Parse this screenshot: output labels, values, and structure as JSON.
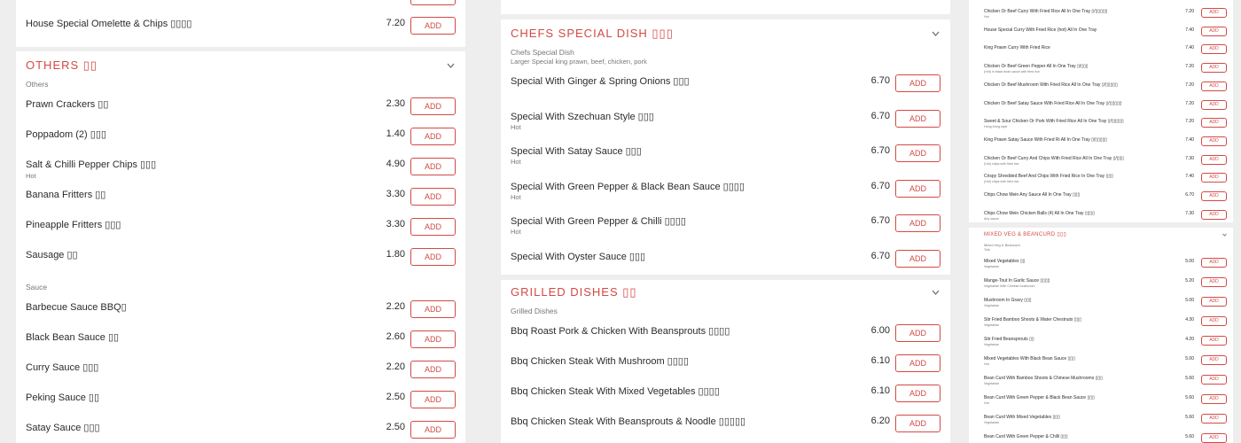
{
  "colA": {
    "top_item": {
      "name": "House Special Omelette & Chips ▯▯▯▯",
      "price": "7.20"
    },
    "others": {
      "title": "OTHERS ▯▯",
      "caption": "Others",
      "items": [
        {
          "name": "Prawn Crackers ▯▯",
          "price": "2.30"
        },
        {
          "name": "Poppadom (2) ▯▯▯",
          "price": "1.40"
        },
        {
          "name": "Salt & Chilli Pepper Chips ▯▯▯",
          "sub": "Hot",
          "price": "4.90"
        },
        {
          "name": "Banana Fritters ▯▯",
          "price": "3.30"
        },
        {
          "name": "Pineapple Fritters ▯▯▯",
          "price": "3.30"
        },
        {
          "name": "Sausage ▯▯",
          "price": "1.80"
        }
      ],
      "sauce_caption": "Sauce",
      "sauces": [
        {
          "name": "Barbecue Sauce BBQ▯",
          "price": "2.20"
        },
        {
          "name": "Black Bean Sauce ▯▯",
          "price": "2.60"
        },
        {
          "name": "Curry Sauce ▯▯▯",
          "price": "2.20"
        },
        {
          "name": "Peking Sauce ▯▯",
          "price": "2.50"
        },
        {
          "name": "Satay Sauce ▯▯▯",
          "price": "2.50"
        }
      ]
    }
  },
  "colB": {
    "chefs": {
      "title": "CHEFS SPECIAL DISH ▯▯▯",
      "caption": "Chefs Special Dish",
      "caption2": "Larger Special king prawn, beef, chicken, pork",
      "items": [
        {
          "name": "Special With Ginger & Spring Onions ▯▯▯",
          "price": "6.70"
        },
        {
          "name": "Special With Szechuan Style ▯▯▯",
          "sub": "Hot",
          "price": "6.70"
        },
        {
          "name": "Special With Satay Sauce ▯▯▯",
          "sub": "Hot",
          "price": "6.70"
        },
        {
          "name": "Special With Green Pepper & Black Bean Sauce ▯▯▯▯",
          "sub": "Hot",
          "price": "6.70"
        },
        {
          "name": "Special With Green Pepper & Chilli ▯▯▯▯",
          "sub": "Hot",
          "price": "6.70"
        },
        {
          "name": "Special With Oyster Sauce ▯▯▯",
          "price": "6.70"
        }
      ]
    },
    "grilled": {
      "title": "GRILLED DISHES ▯▯",
      "caption": "Grilled Dishes",
      "items": [
        {
          "name": "Bbq Roast Pork & Chicken With Beansprouts ▯▯▯▯",
          "price": "6.00"
        },
        {
          "name": "Bbq Chicken Steak With Mushroom ▯▯▯▯",
          "price": "6.10"
        },
        {
          "name": "Bbq Chicken Steak With Mixed Vegetables ▯▯▯▯",
          "price": "6.10"
        },
        {
          "name": "Bbq Chicken Steak With Beansprouts & Noodle ▯▯▯▯▯",
          "price": "6.20"
        }
      ]
    }
  },
  "colC": {
    "items": [
      {
        "name": "Chicken Or Beef Curry With Fried Rice All In One Tray ▯/▯▯▯▯▯",
        "sub": "Hot",
        "price": "7.20"
      },
      {
        "name": "House Special Curry With Fried Rice (hot) All In One Tray",
        "price": "7.40"
      },
      {
        "name": "King Prawn Curry With Fried Rice",
        "price": "7.40"
      },
      {
        "name": "Chicken Or Beef Green Pepper All In One Tray ▯/▯▯▯",
        "sub": "(Hot) in black bean sauce with fried rice",
        "price": "7.20"
      },
      {
        "name": "Chicken Or Beef Mushroom With Fried Rice All In One Tray ▯/▯▯▯▯▯",
        "price": "7.20"
      },
      {
        "name": "Chicken Or Beef Satay Sauce With Fried Rice All In One Tray ▯/▯▯▯▯▯",
        "price": "7.20"
      },
      {
        "name": "Sweet & Sour Chicken Or Pork With Fried Rice All In One Tray ▯/▯▯▯▯▯",
        "sub": "Hong Kong style",
        "price": "7.20"
      },
      {
        "name": "King Prawn Satay Sauce With Fried Ri All In One Tray ▯/▯▯▯▯▯",
        "price": "7.40"
      },
      {
        "name": "Chicken Or Beef Curry And Chips With Fried Rice All In One Tray ▯/▯▯▯",
        "sub": "(Hot) chips with fried rice",
        "price": "7.30"
      },
      {
        "name": "Crispy Shredded Beef And Chips With Fried Rice In One Tray ▯▯▯",
        "sub": "(Hot) chips with fried rice",
        "price": "7.40"
      },
      {
        "name": "Chips Chow Mein Any Sauce All In One Tray ▯▯▯",
        "price": "6.70"
      },
      {
        "name": "Chips Chow Mein Chicken Balls (4) All In One Tray ▯▯▯▯",
        "sub": "Any sauce",
        "price": "7.30"
      }
    ],
    "veg": {
      "title": "MIXED VEG & BEANCURD ▯▯▯",
      "caption": "Mixed Veg & Beancurd",
      "caption2": "Tofu",
      "items": [
        {
          "name": "Mixed Vegetables ▯▯",
          "sub": "Vegetarian",
          "price": "5.00"
        },
        {
          "name": "Mange-Tout In Garlic Sauce ▯▯▯▯",
          "sub": "Vegetarian With Chinese mushroom",
          "price": "5.20"
        },
        {
          "name": "Mushroom In Gravy ▯▯▯",
          "sub": "Vegetarian",
          "price": "5.00"
        },
        {
          "name": "Stir Fried Bamboo Shoots & Water Chestnuts ▯▯▯",
          "sub": "Vegetarian",
          "price": "4.30"
        },
        {
          "name": "Stir Fried Beansprouts ▯▯",
          "sub": "Vegetarian",
          "price": "4.20"
        },
        {
          "name": "Mixed Vegetables With Black Bean Sauce ▯▯▯",
          "sub": "Hot",
          "price": "5.00"
        },
        {
          "name": "Bean Curd With Bamboo Shoots & Chinese Mushrooms ▯▯▯",
          "sub": "Vegetarian",
          "price": "5.60"
        },
        {
          "name": "Bean Curd With Green Pepper & Black Bean Sauce ▯▯▯",
          "sub": "Hot",
          "price": "5.60"
        },
        {
          "name": "Bean Curd With Mixed Vegetables ▯▯▯",
          "sub": "Vegetarian",
          "price": "5.60"
        },
        {
          "name": "Bean Curd With Green Pepper & Chilli ▯▯▯",
          "price": "5.60"
        }
      ]
    }
  },
  "labels": {
    "add": "ADD"
  },
  "colors": {
    "accent": "#d24a45",
    "background": "#eeeeee",
    "card": "#ffffff"
  }
}
